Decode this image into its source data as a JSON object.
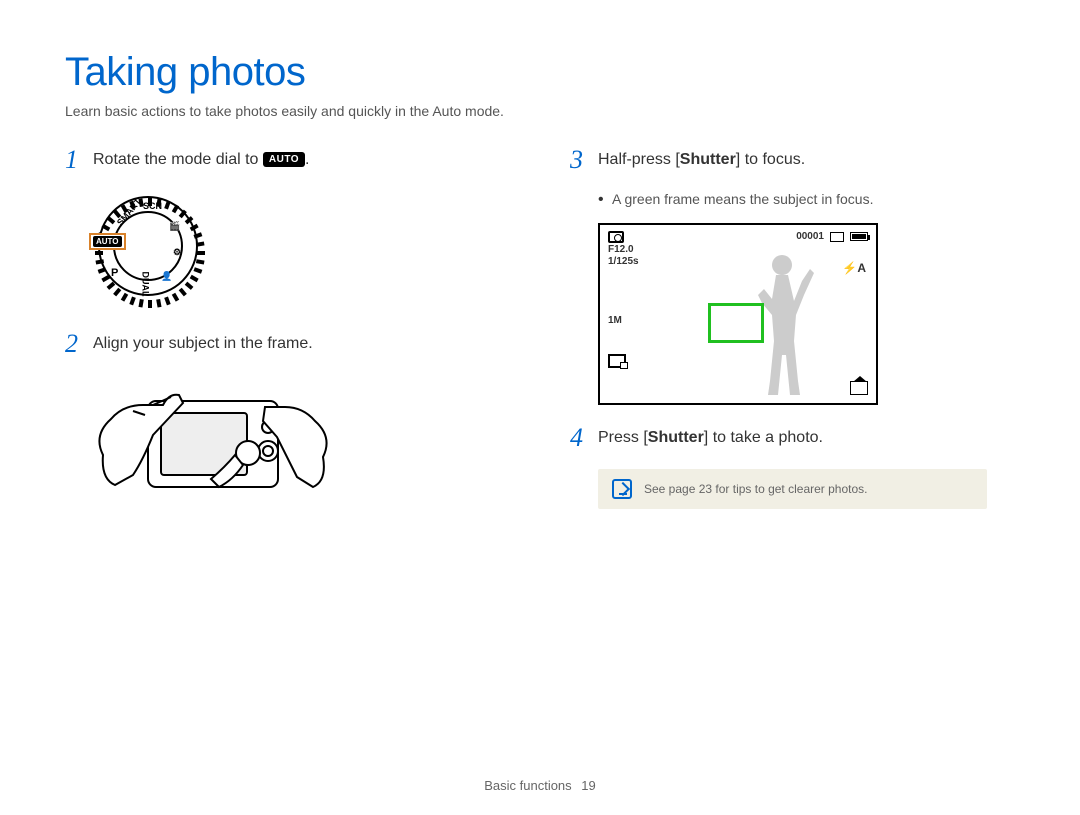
{
  "title": "Taking photos",
  "subtitle": "Learn basic actions to take photos easily and quickly in the Auto mode.",
  "steps": {
    "s1": {
      "num": "1",
      "text_before": "Rotate the mode dial to ",
      "chip": "AUTO",
      "text_after": "."
    },
    "s2": {
      "num": "2",
      "text": "Align your subject in the frame."
    },
    "s3": {
      "num": "3",
      "text_before": "Half-press [",
      "bold": "Shutter",
      "text_after": "] to focus."
    },
    "s3_bullet": "A green frame means the subject in focus.",
    "s4": {
      "num": "4",
      "text_before": "Press [",
      "bold": "Shutter",
      "text_after": "] to take a photo."
    }
  },
  "dial": {
    "auto_label": "AUTO",
    "labels": {
      "scn": "SCN",
      "dual": "DUAL",
      "smart": "SMART",
      "p": "P"
    }
  },
  "lcd": {
    "f": "F12.0",
    "shutter": "1/125s",
    "counter": "00001",
    "size": "1M",
    "flash": "A"
  },
  "note": "See page 23 for tips to get clearer photos.",
  "footer": {
    "section": "Basic functions",
    "page": "19"
  }
}
